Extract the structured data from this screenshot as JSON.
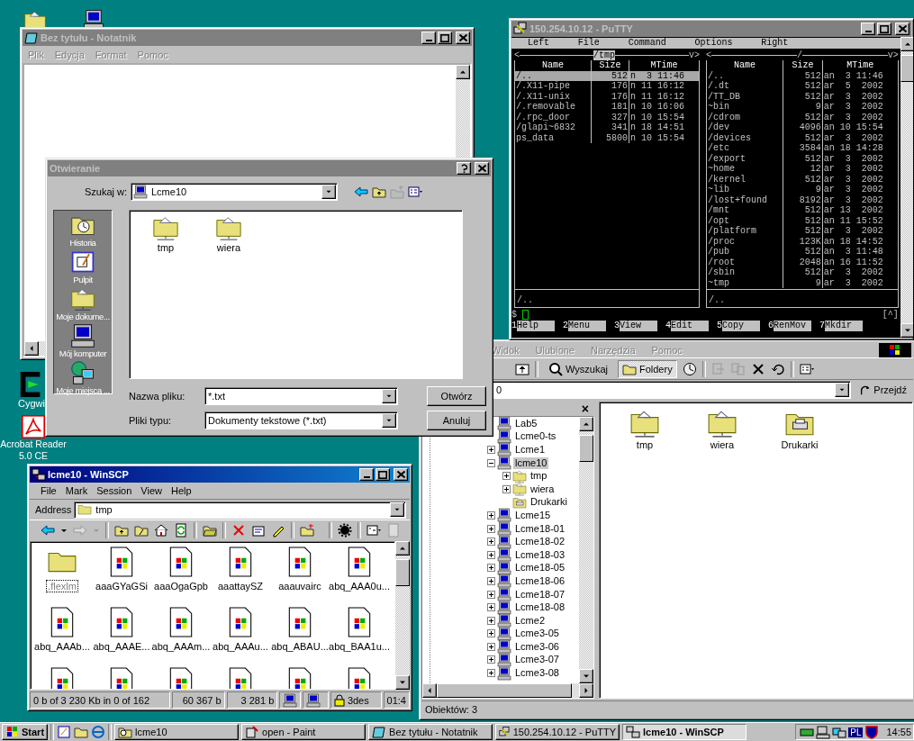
{
  "desktop_icons": [
    {
      "label": "Cygwi"
    },
    {
      "label": "Acrobat Reader 5.0 CE"
    }
  ],
  "notepad": {
    "title": "Bez tytułu - Notatnik",
    "active": false,
    "menu_disabled": true,
    "menu": [
      "Plik",
      "Edycja",
      "Format",
      "Pomoc"
    ]
  },
  "open_dialog": {
    "title": "Otwieranie",
    "active": false,
    "look_in_label": "Szukaj w:",
    "look_in_value": "Lcme10",
    "places": [
      {
        "kind": "history",
        "label": "Historia"
      },
      {
        "kind": "desktop",
        "label": "Pulpit"
      },
      {
        "kind": "documents",
        "label": "Moje dokume..."
      },
      {
        "kind": "computer",
        "label": "Mój komputer"
      },
      {
        "kind": "network",
        "label": "Moje miejsca ..."
      }
    ],
    "files": [
      {
        "name": "tmp"
      },
      {
        "name": "wiera"
      }
    ],
    "filename_label": "Nazwa pliku:",
    "filename_value": "*.txt",
    "filetype_label": "Pliki typu:",
    "filetype_value": "Dokumenty tekstowe (*.txt)",
    "buttons": [
      "Otwórz",
      "Anuluj"
    ]
  },
  "putty": {
    "title": "150.254.10.12 - PuTTY",
    "active": false,
    "menu": [
      "Left",
      "File",
      "Command",
      "Options",
      "Right"
    ],
    "left_panel": {
      "left_marker": "<",
      "right_marker": "v>",
      "path": "/tmp",
      "columns": [
        "Name",
        "Size",
        "MTime"
      ],
      "status": "/..",
      "rows": [
        {
          "name": "/..",
          "size": "512",
          "mtime": "n  3 11:46",
          "selected": true
        },
        {
          "name": "/.X11-pipe",
          "size": "176",
          "mtime": "n 11 16:12",
          "selected": false
        },
        {
          "name": "/.X11-unix",
          "size": "176",
          "mtime": "n 11 16:12",
          "selected": false
        },
        {
          "name": "/.removable",
          "size": "181",
          "mtime": "n 10 16:06",
          "selected": false
        },
        {
          "name": "/.rpc_door",
          "size": "327",
          "mtime": "n 10 15:54",
          "selected": false
        },
        {
          "name": "/glapi~6832",
          "size": "341",
          "mtime": "n 18 14:51",
          "selected": false
        },
        {
          "name": "ps_data",
          "size": "5800",
          "mtime": "n 10 15:54",
          "selected": false
        }
      ]
    },
    "right_panel": {
      "left_marker": "<",
      "right_marker": "v>",
      "path": "/",
      "columns": [
        "Name",
        "Size",
        "MTime"
      ],
      "status": "/..",
      "rows": [
        {
          "name": "/..",
          "size": "512",
          "mtime": "an  3 11:46",
          "selected": false
        },
        {
          "name": "/.dt",
          "size": "512",
          "mtime": "ar  5  2002",
          "selected": false
        },
        {
          "name": "/TT_DB",
          "size": "512",
          "mtime": "ar  3  2002",
          "selected": false
        },
        {
          "name": "~bin",
          "size": "9",
          "mtime": "ar  3  2002",
          "selected": false
        },
        {
          "name": "/cdrom",
          "size": "512",
          "mtime": "ar  3  2002",
          "selected": false
        },
        {
          "name": "/dev",
          "size": "4096",
          "mtime": "an 10 15:54",
          "selected": false
        },
        {
          "name": "/devices",
          "size": "512",
          "mtime": "ar  3  2002",
          "selected": false
        },
        {
          "name": "/etc",
          "size": "3584",
          "mtime": "an 18 14:28",
          "selected": false
        },
        {
          "name": "/export",
          "size": "512",
          "mtime": "ar  3  2002",
          "selected": false
        },
        {
          "name": "~home",
          "size": "12",
          "mtime": "ar  3  2002",
          "selected": false
        },
        {
          "name": "/kernel",
          "size": "512",
          "mtime": "ar  3  2002",
          "selected": false
        },
        {
          "name": "~lib",
          "size": "9",
          "mtime": "ar  3  2002",
          "selected": false
        },
        {
          "name": "/lost+found",
          "size": "8192",
          "mtime": "ar  3  2002",
          "selected": false
        },
        {
          "name": "/mnt",
          "size": "512",
          "mtime": "ar 13  2002",
          "selected": false
        },
        {
          "name": "/opt",
          "size": "512",
          "mtime": "an 11 15:52",
          "selected": false
        },
        {
          "name": "/platform",
          "size": "512",
          "mtime": "ar  3  2002",
          "selected": false
        },
        {
          "name": "/proc",
          "size": "123K",
          "mtime": "an 18 14:52",
          "selected": false
        },
        {
          "name": "/pub",
          "size": "512",
          "mtime": "an  3 11:48",
          "selected": false
        },
        {
          "name": "/root",
          "size": "2048",
          "mtime": "an 16 11:52",
          "selected": false
        },
        {
          "name": "/sbin",
          "size": "512",
          "mtime": "ar  3  2002",
          "selected": false
        },
        {
          "name": "~tmp",
          "size": "9",
          "mtime": "ar  3  2002",
          "selected": false
        }
      ]
    },
    "prompt": "$",
    "prompt_right": "[^]",
    "fkeys": [
      {
        "key": "1",
        "label": "Help"
      },
      {
        "key": "2",
        "label": "Menu"
      },
      {
        "key": "3",
        "label": "View"
      },
      {
        "key": "4",
        "label": "Edit"
      },
      {
        "key": "5",
        "label": "Copy"
      },
      {
        "key": "6",
        "label": "RenMov"
      },
      {
        "key": "7",
        "label": "Mkdir"
      }
    ]
  },
  "explorer": {
    "menu_disabled": true,
    "menu": [
      "Widok",
      "Ulubione",
      "Narzędzia",
      "Pomoc"
    ],
    "toolbar": [
      {
        "label": "Wyszukaj",
        "selected": false
      },
      {
        "label": "Foldery",
        "selected": true
      }
    ],
    "address_value": "0",
    "go_label": "Przejdź",
    "tree_close": "×",
    "tree": [
      {
        "kind": "computer",
        "label": "Lab5",
        "selected": false
      },
      {
        "kind": "computer",
        "label": "Lcme0-ts",
        "selected": false
      },
      {
        "kind": "computer",
        "label": "Lcme1",
        "expanded": false,
        "selected": false
      },
      {
        "kind": "computer",
        "label": "lcme10",
        "expanded": true,
        "selected": true,
        "children": [
          {
            "kind": "shared",
            "label": "tmp",
            "expanded": false,
            "selected": false
          },
          {
            "kind": "shared",
            "label": "wiera",
            "expanded": false,
            "selected": false
          },
          {
            "kind": "printers",
            "label": "Drukarki",
            "selected": false
          }
        ]
      },
      {
        "kind": "computer",
        "label": "Lcme15",
        "expanded": false,
        "selected": false
      },
      {
        "kind": "computer",
        "label": "Lcme18-01",
        "expanded": false,
        "selected": false
      },
      {
        "kind": "computer",
        "label": "Lcme18-02",
        "expanded": false,
        "selected": false
      },
      {
        "kind": "computer",
        "label": "Lcme18-03",
        "expanded": false,
        "selected": false
      },
      {
        "kind": "computer",
        "label": "Lcme18-05",
        "expanded": false,
        "selected": false
      },
      {
        "kind": "computer",
        "label": "Lcme18-06",
        "expanded": false,
        "selected": false
      },
      {
        "kind": "computer",
        "label": "Lcme18-07",
        "expanded": false,
        "selected": false
      },
      {
        "kind": "computer",
        "label": "Lcme18-08",
        "expanded": false,
        "selected": false
      },
      {
        "kind": "computer",
        "label": "Lcme2",
        "expanded": false,
        "selected": false
      },
      {
        "kind": "computer",
        "label": "Lcme3-05",
        "expanded": false,
        "selected": false
      },
      {
        "kind": "computer",
        "label": "Lcme3-06",
        "expanded": false,
        "selected": false
      },
      {
        "kind": "computer",
        "label": "Lcme3-07",
        "expanded": false,
        "selected": false
      },
      {
        "kind": "computer",
        "label": "Lcme3-08",
        "expanded": false,
        "selected": false
      }
    ],
    "files": [
      {
        "kind": "shared",
        "name": "tmp"
      },
      {
        "kind": "shared",
        "name": "wiera"
      },
      {
        "kind": "printers",
        "name": "Drukarki"
      }
    ],
    "status": "Obiektów: 3"
  },
  "winscp": {
    "title": "lcme10 - WinSCP",
    "active": true,
    "menu": [
      "File",
      "Mark",
      "Session",
      "View",
      "Help"
    ],
    "address_label": "Address",
    "address_value": "tmp",
    "files": [
      {
        "kind": "folder",
        "name": ".flexlm",
        "focused": true
      },
      {
        "kind": "file",
        "name": "aaaGYaGSi",
        "focused": false
      },
      {
        "kind": "file",
        "name": "aaaOgaGpb",
        "focused": false
      },
      {
        "kind": "file",
        "name": "aaattaySZ",
        "focused": false
      },
      {
        "kind": "file",
        "name": "aaauvairc",
        "focused": false
      },
      {
        "kind": "file",
        "name": "abq_AAA0u...",
        "focused": false
      },
      {
        "kind": "file",
        "name": "abq_AAAb...",
        "focused": false
      },
      {
        "kind": "file",
        "name": "abq_AAAE...",
        "focused": false
      },
      {
        "kind": "file",
        "name": "abq_AAAm...",
        "focused": false
      },
      {
        "kind": "file",
        "name": "abq_AAAu...",
        "focused": false
      },
      {
        "kind": "file",
        "name": "abq_ABAU...",
        "focused": false
      },
      {
        "kind": "file",
        "name": "abq_BAA1u...",
        "focused": false
      },
      {
        "kind": "file"
      },
      {
        "kind": "file"
      },
      {
        "kind": "file"
      },
      {
        "kind": "file"
      },
      {
        "kind": "file"
      },
      {
        "kind": "file"
      }
    ],
    "status": {
      "selection": "0 b of 3 230 Kb in 0 of 162",
      "received": "60 367 b",
      "sent": "3 281 b",
      "cipher": "3des",
      "time": "01:4"
    }
  },
  "taskbar": {
    "start": "Start",
    "tasks": [
      {
        "kind": "explorer",
        "label": "lcme10",
        "selected": false
      },
      {
        "kind": "paint",
        "label": "open - Paint",
        "selected": false
      },
      {
        "kind": "notepad",
        "label": "Bez tytułu - Notatnik",
        "selected": false
      },
      {
        "kind": "putty",
        "label": "150.254.10.12 - PuTTY",
        "selected": false
      },
      {
        "kind": "winscp",
        "label": "lcme10 - WinSCP",
        "selected": true
      }
    ],
    "language": "PL",
    "clock": "14:55"
  }
}
